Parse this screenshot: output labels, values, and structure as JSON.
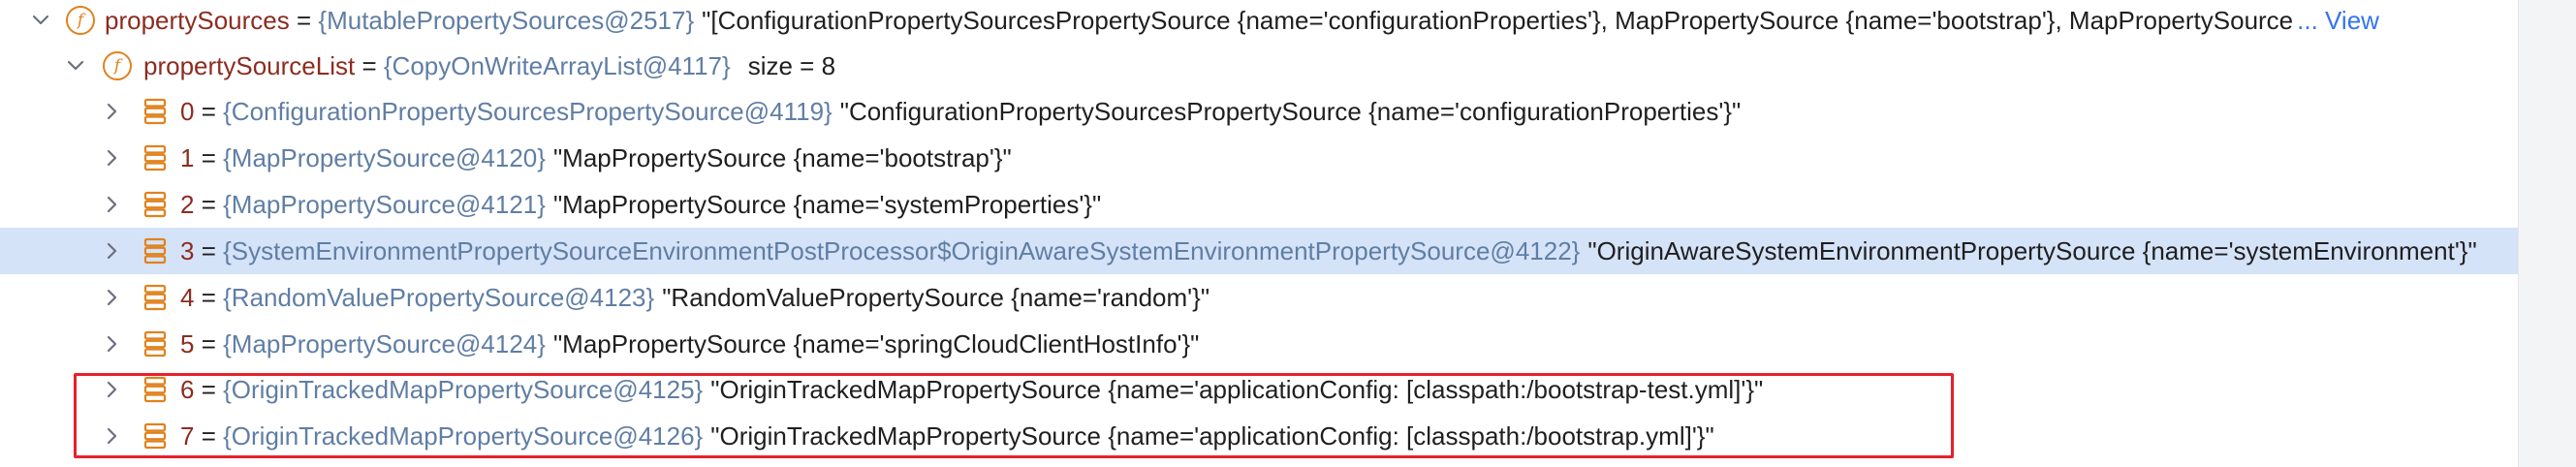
{
  "colors": {
    "field_name": "#8c2c20",
    "type_ref": "#607ea4",
    "value_text": "#1f1f1f",
    "link": "#3574f0",
    "selected_row": "#d5e3f8",
    "annotation_border": "#e8202c",
    "field_icon": "#e0821e"
  },
  "root": {
    "expander_icon": "chevron-down-icon",
    "icon": "field-icon",
    "icon_letter": "f",
    "name": "propertySources",
    "eq": " = ",
    "type": "{MutablePropertySources@2517}",
    "value": "\"[ConfigurationPropertySourcesPropertySource {name='configurationProperties'}, MapPropertySource {name='bootstrap'}, MapPropertySource",
    "link": "... View"
  },
  "list": {
    "expander_icon": "chevron-down-icon",
    "icon": "field-icon",
    "icon_letter": "f",
    "name": "propertySourceList",
    "eq": " = ",
    "type": "{CopyOnWriteArrayList@4117}",
    "size": "size = 8"
  },
  "items": [
    {
      "index": "0",
      "eq": " = ",
      "type": "{ConfigurationPropertySourcesPropertySource@4119}",
      "value": "\"ConfigurationPropertySourcesPropertySource {name='configurationProperties'}\"",
      "selected": false
    },
    {
      "index": "1",
      "eq": " = ",
      "type": "{MapPropertySource@4120}",
      "value": "\"MapPropertySource {name='bootstrap'}\"",
      "selected": false
    },
    {
      "index": "2",
      "eq": " = ",
      "type": "{MapPropertySource@4121}",
      "value": "\"MapPropertySource {name='systemProperties'}\"",
      "selected": false
    },
    {
      "index": "3",
      "eq": " = ",
      "type": "{SystemEnvironmentPropertySourceEnvironmentPostProcessor$OriginAwareSystemEnvironmentPropertySource@4122}",
      "value": "\"OriginAwareSystemEnvironmentPropertySource {name='systemEnvironment'}\"",
      "selected": true
    },
    {
      "index": "4",
      "eq": " = ",
      "type": "{RandomValuePropertySource@4123}",
      "value": "\"RandomValuePropertySource {name='random'}\"",
      "selected": false
    },
    {
      "index": "5",
      "eq": " = ",
      "type": "{MapPropertySource@4124}",
      "value": "\"MapPropertySource {name='springCloudClientHostInfo'}\"",
      "selected": false
    },
    {
      "index": "6",
      "eq": " = ",
      "type": "{OriginTrackedMapPropertySource@4125}",
      "value": "\"OriginTrackedMapPropertySource {name='applicationConfig: [classpath:/bootstrap-test.yml]'}\"",
      "selected": false
    },
    {
      "index": "7",
      "eq": " = ",
      "type": "{OriginTrackedMapPropertySource@4126}",
      "value": "\"OriginTrackedMapPropertySource {name='applicationConfig: [classpath:/bootstrap.yml]'}\"",
      "selected": false
    }
  ],
  "item_icons": {
    "expander": "chevron-right-icon",
    "element": "list-element-icon"
  }
}
